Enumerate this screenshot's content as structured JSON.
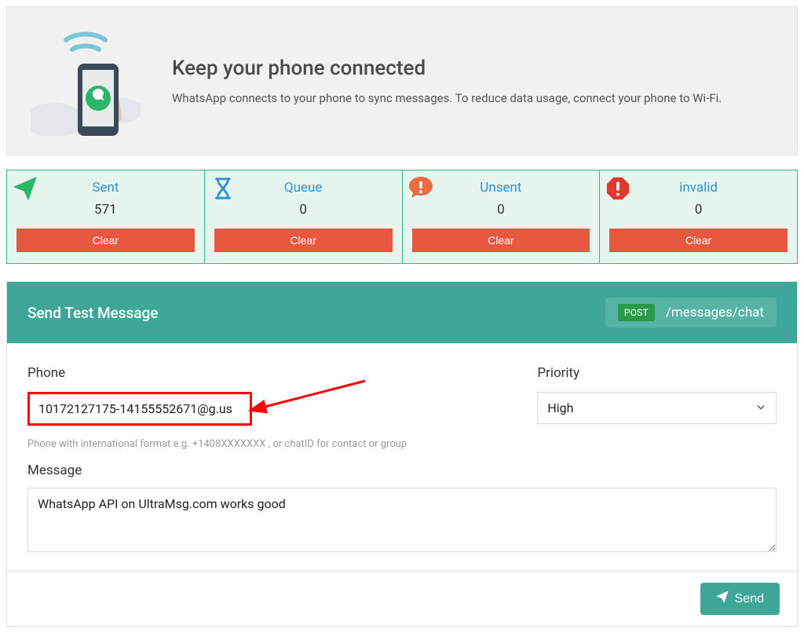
{
  "banner": {
    "title": "Keep your phone connected",
    "subtitle": "WhatsApp connects to your phone to sync messages. To reduce data usage, connect your phone to Wi-Fi."
  },
  "stats": [
    {
      "title": "Sent",
      "value": "571",
      "clear": "Clear"
    },
    {
      "title": "Queue",
      "value": "0",
      "clear": "Clear"
    },
    {
      "title": "Unsent",
      "value": "0",
      "clear": "Clear"
    },
    {
      "title": "invalid",
      "value": "0",
      "clear": "Clear"
    }
  ],
  "panel": {
    "title": "Send Test Message",
    "method": "POST",
    "path": "/messages/chat",
    "phone_label": "Phone",
    "phone_value": "10172127175-14155552671@g.us",
    "phone_help": "Phone with international format e.g. +1408XXXXXXX , or chatID for contact or group",
    "priority_label": "Priority",
    "priority_value": "High",
    "message_label": "Message",
    "message_value": "WhatsApp API on UltraMsg.com works good",
    "send_label": "Send"
  }
}
